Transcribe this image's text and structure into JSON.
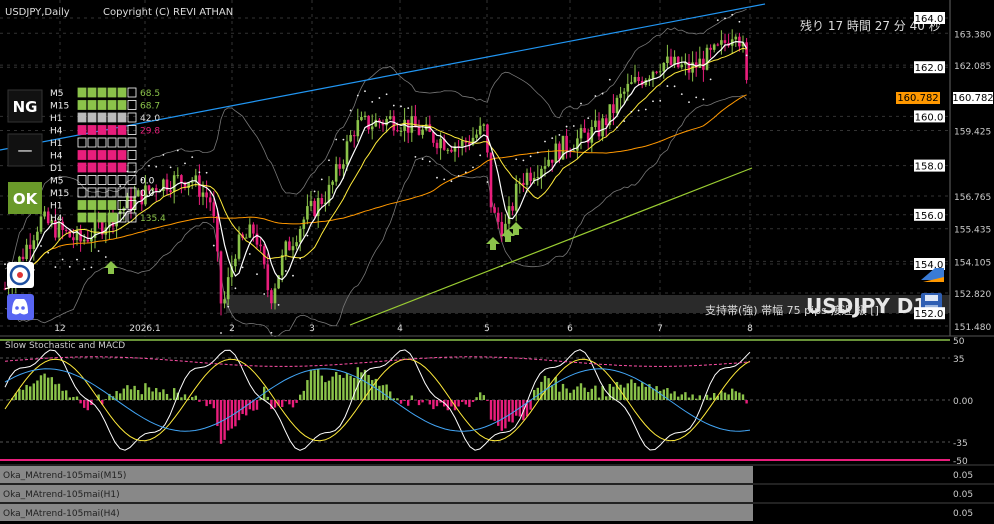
{
  "chart": {
    "symbol_title": "USDJPY,Daily",
    "copyright": "Copyright (C) REVI ATHAN",
    "countdown": "残り 17 時間 27 分 40 秒",
    "watermark": "USDJPY D1",
    "support_text": "支持帯(強) 帯幅 75 pips 接近 級 []",
    "current_price": "160.782"
  },
  "price_axis": [
    {
      "label": "164.0",
      "value": 164.0,
      "boxed": true
    },
    {
      "label": "163.380",
      "value": 163.38,
      "boxed": false
    },
    {
      "label": "162.0",
      "value": 162.0,
      "boxed": true
    },
    {
      "label": "162.085",
      "value": 162.085,
      "boxed": false
    },
    {
      "label": "160.0",
      "value": 160.0,
      "boxed": true
    },
    {
      "label": "159.425",
      "value": 159.425,
      "boxed": false
    },
    {
      "label": "158.0",
      "value": 158.0,
      "boxed": true
    },
    {
      "label": "156.765",
      "value": 156.765,
      "boxed": false
    },
    {
      "label": "156.0",
      "value": 156.0,
      "boxed": true
    },
    {
      "label": "155.435",
      "value": 155.435,
      "boxed": false
    },
    {
      "label": "154.0",
      "value": 154.0,
      "boxed": true
    },
    {
      "label": "154.105",
      "value": 154.105,
      "boxed": false
    },
    {
      "label": "152.820",
      "value": 152.82,
      "boxed": false
    },
    {
      "label": "152.0",
      "value": 152.0,
      "boxed": true
    },
    {
      "label": "151.480",
      "value": 151.48,
      "boxed": false
    }
  ],
  "date_axis": [
    "12",
    "2026.1",
    "2",
    "3",
    "4",
    "5",
    "6",
    "7",
    "8"
  ],
  "strength_panel": {
    "badges": [
      "NG",
      "—",
      "OK"
    ],
    "rows": [
      {
        "tf": "M5",
        "value": "68.5",
        "color": "#8bc34a"
      },
      {
        "tf": "M15",
        "value": "68.7",
        "color": "#8bc34a"
      },
      {
        "tf": "H1",
        "value": "42.0",
        "color": "#bbbbbb"
      },
      {
        "tf": "H4",
        "value": "29.8",
        "color": "#e91e7c"
      },
      {
        "tf": "H1",
        "value": "",
        "color": "#ffffff"
      },
      {
        "tf": "H4",
        "value": "",
        "color": "#e91e7c"
      },
      {
        "tf": "D1",
        "value": "",
        "color": "#e91e7c"
      },
      {
        "tf": "M5",
        "value": "0.0",
        "color": "#ffffff"
      },
      {
        "tf": "M15",
        "value": "0.0",
        "color": "#ffffff"
      },
      {
        "tf": "H1",
        "value": "",
        "color": "#8bc34a"
      },
      {
        "tf": "H4",
        "value": "135.4",
        "color": "#8bc34a"
      }
    ]
  },
  "oscillator": {
    "title": "Slow Stochastic and MACD",
    "levels": [
      {
        "label": "50",
        "value": 50
      },
      {
        "label": "35",
        "value": 35
      },
      {
        "label": "0.00",
        "value": 0
      },
      {
        "label": "-35",
        "value": -35
      },
      {
        "label": "-50",
        "value": -50
      }
    ]
  },
  "sub_panels": [
    {
      "title": "Oka_MAtrend-105mai(M15)",
      "value": "0.05"
    },
    {
      "title": "Oka_MAtrend-105mai(H1)",
      "value": "0.05"
    },
    {
      "title": "Oka_MAtrend-105mai(H4)",
      "value": "0.05"
    }
  ],
  "colors": {
    "bull": "#8bc34a",
    "bear": "#e91e7c",
    "trend_upper": "#2196f3",
    "trend_lower": "#9acd32",
    "ma_long": "#ff9800",
    "ma_mid": "#ffeb3b",
    "ma_short": "#ffffff"
  }
}
